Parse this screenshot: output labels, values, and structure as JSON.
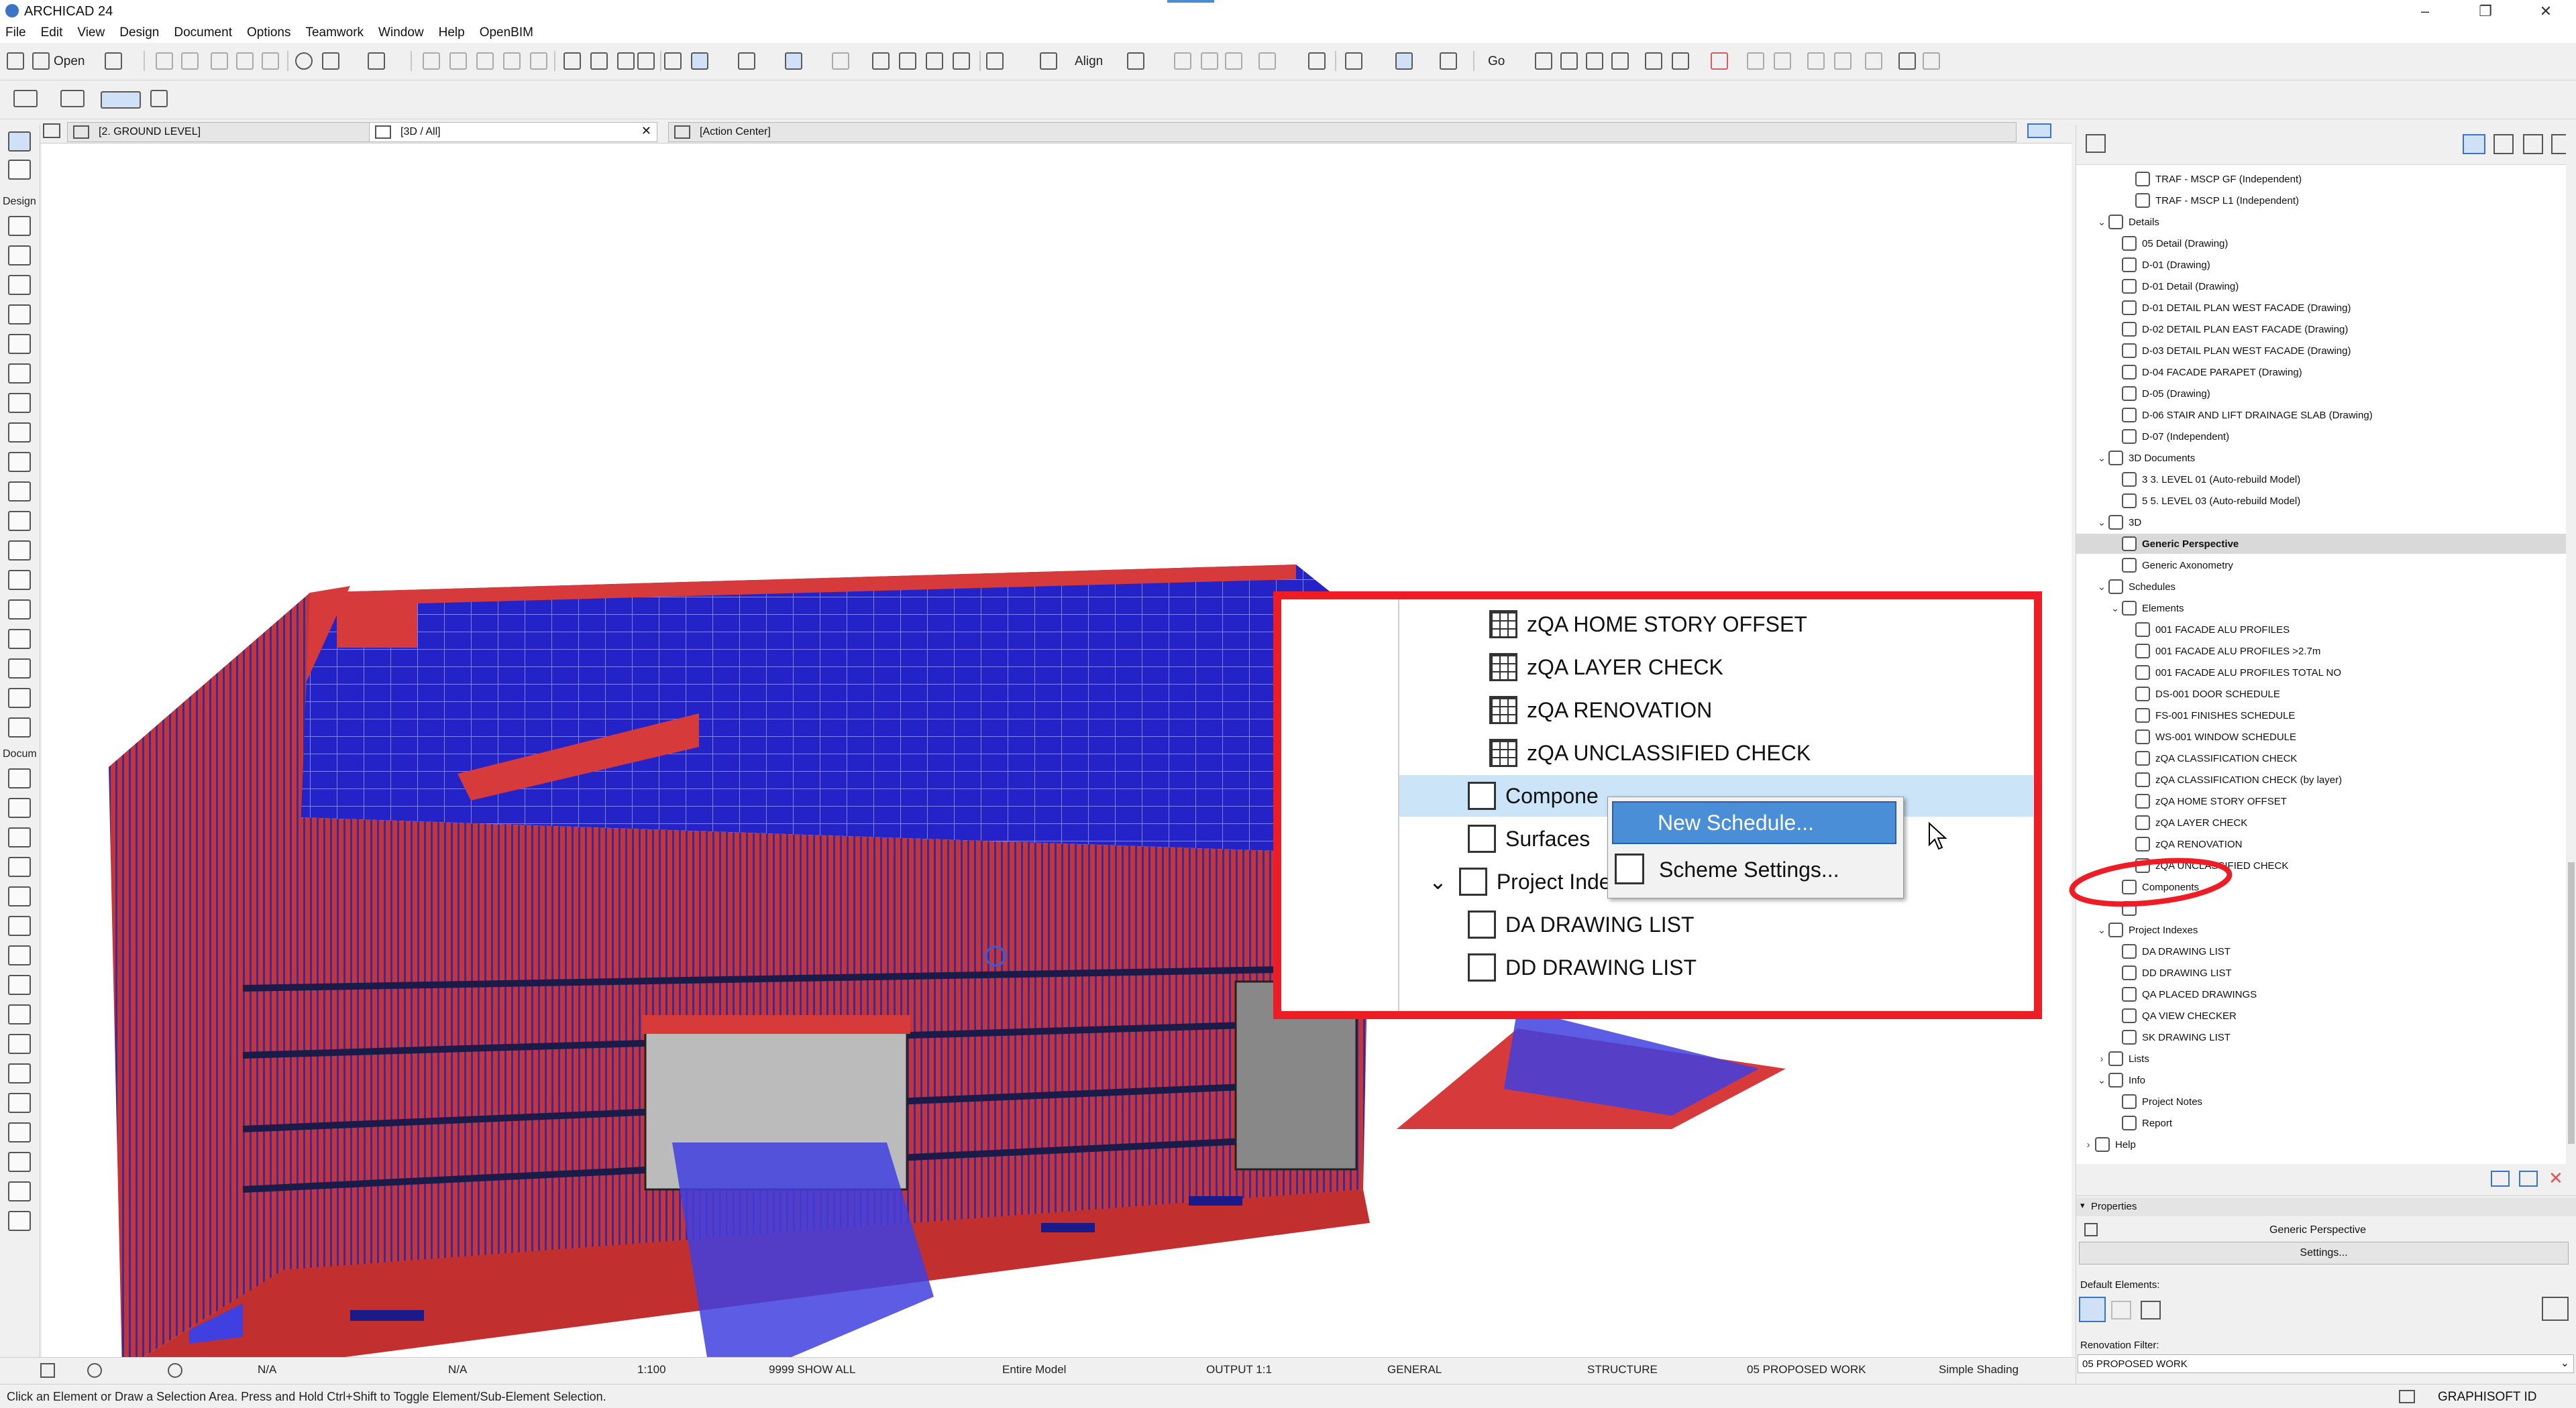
{
  "app": {
    "title": "ARCHICAD 24"
  },
  "menu": [
    "File",
    "Edit",
    "View",
    "Design",
    "Document",
    "Options",
    "Teamwork",
    "Window",
    "Help",
    "OpenBIM"
  ],
  "toolbar": {
    "open_label": "Open",
    "align_label": "Align",
    "go_label": "Go"
  },
  "left_toolbox": {
    "design_label": "Design",
    "document_label": "Docum"
  },
  "tabs": [
    {
      "label": "[2. GROUND LEVEL]"
    },
    {
      "label": "[3D / All]"
    },
    {
      "label": "[Action Center]"
    }
  ],
  "status": {
    "angle1": "N/A",
    "angle2": "N/A",
    "scale": "1:100",
    "layer_combo": "9999 SHOW ALL",
    "model": "Entire Model",
    "output": "OUTPUT 1:1",
    "general": "GENERAL",
    "structure": "STRUCTURE",
    "renovation": "05 PROPOSED WORK",
    "shading": "Simple Shading"
  },
  "hint": "Click an Element or Draw a Selection Area. Press and Hold Ctrl+Shift to Toggle Element/Sub-Element Selection.",
  "navigator": [
    {
      "label": "TRAF - MSCP GF (Independent)",
      "level": 3
    },
    {
      "label": "TRAF - MSCP L1 (Independent)",
      "level": 3
    },
    {
      "label": "Details",
      "level": 1,
      "expander": "⌄"
    },
    {
      "label": "05 Detail (Drawing)",
      "level": 2
    },
    {
      "label": "D-01 (Drawing)",
      "level": 2
    },
    {
      "label": "D-01 Detail (Drawing)",
      "level": 2
    },
    {
      "label": "D-01 DETAIL PLAN WEST FACADE (Drawing)",
      "level": 2
    },
    {
      "label": "D-02 DETAIL PLAN EAST FACADE (Drawing)",
      "level": 2
    },
    {
      "label": "D-03 DETAIL PLAN WEST FACADE (Drawing)",
      "level": 2
    },
    {
      "label": "D-04 FACADE PARAPET  (Drawing)",
      "level": 2
    },
    {
      "label": "D-05 (Drawing)",
      "level": 2
    },
    {
      "label": "D-06 STAIR AND LIFT DRAINAGE SLAB (Drawing)",
      "level": 2
    },
    {
      "label": "D-07 (Independent)",
      "level": 2
    },
    {
      "label": "3D Documents",
      "level": 1,
      "expander": "⌄"
    },
    {
      "label": "3 3. LEVEL 01 (Auto-rebuild Model)",
      "level": 2
    },
    {
      "label": "5 5. LEVEL 03 (Auto-rebuild Model)",
      "level": 2
    },
    {
      "label": "3D",
      "level": 1,
      "expander": "⌄"
    },
    {
      "label": "Generic Perspective",
      "level": 2,
      "selected": true
    },
    {
      "label": "Generic Axonometry",
      "level": 2
    },
    {
      "label": "Schedules",
      "level": 1,
      "expander": "⌄"
    },
    {
      "label": "Elements",
      "level": 2,
      "expander": "⌄"
    },
    {
      "label": "001 FACADE ALU PROFILES",
      "level": 3
    },
    {
      "label": "001 FACADE ALU PROFILES >2.7m",
      "level": 3
    },
    {
      "label": "001 FACADE ALU PROFILES TOTAL NO",
      "level": 3
    },
    {
      "label": "DS-001 DOOR SCHEDULE",
      "level": 3
    },
    {
      "label": "FS-001 FINISHES SCHEDULE",
      "level": 3
    },
    {
      "label": "WS-001 WINDOW SCHEDULE",
      "level": 3
    },
    {
      "label": "zQA CLASSIFICATION CHECK",
      "level": 3
    },
    {
      "label": "zQA CLASSIFICATION CHECK (by layer)",
      "level": 3
    },
    {
      "label": "zQA HOME STORY OFFSET",
      "level": 3
    },
    {
      "label": "zQA LAYER CHECK",
      "level": 3
    },
    {
      "label": "zQA RENOVATION",
      "level": 3
    },
    {
      "label": "zQA UNCLASSIFIED CHECK",
      "level": 3
    },
    {
      "label": "Components",
      "level": 2
    },
    {
      "label": "",
      "level": 2
    },
    {
      "label": "Project Indexes",
      "level": 1,
      "expander": "⌄"
    },
    {
      "label": "DA DRAWING LIST",
      "level": 2
    },
    {
      "label": "DD DRAWING LIST",
      "level": 2
    },
    {
      "label": "QA PLACED DRAWINGS",
      "level": 2
    },
    {
      "label": "QA VIEW CHECKER",
      "level": 2
    },
    {
      "label": "SK DRAWING LIST",
      "level": 2
    },
    {
      "label": "Lists",
      "level": 1,
      "expander": "›"
    },
    {
      "label": "Info",
      "level": 1,
      "expander": "⌄"
    },
    {
      "label": "Project Notes",
      "level": 2
    },
    {
      "label": "Report",
      "level": 2
    },
    {
      "label": "Help",
      "level": 0,
      "expander": "›"
    }
  ],
  "properties": {
    "header": "Properties",
    "view_name": "Generic Perspective",
    "settings_btn": "Settings...",
    "default_elements_label": "Default Elements:",
    "renovation_filter_label": "Renovation Filter:",
    "renovation_filter_value": "05 PROPOSED WORK",
    "brand": "GRAPHISOFT ID"
  },
  "zoom_callout": {
    "items": [
      {
        "label": "zQA HOME STORY OFFSET",
        "icon": "schedule-icon"
      },
      {
        "label": "zQA LAYER CHECK",
        "icon": "schedule-icon"
      },
      {
        "label": "zQA RENOVATION",
        "icon": "schedule-icon"
      },
      {
        "label": "zQA UNCLASSIFIED CHECK",
        "icon": "schedule-icon"
      },
      {
        "label": "Compone",
        "icon": "components-icon",
        "highlight": true
      },
      {
        "label": "Surfaces",
        "icon": "surfaces-icon"
      },
      {
        "label": "Project Index",
        "icon": "project-index-icon",
        "expander": "⌄"
      },
      {
        "label": "DA DRAWING LIST",
        "icon": "index-icon"
      },
      {
        "label": "DD DRAWING LIST",
        "icon": "index-icon"
      }
    ],
    "context_menu": [
      {
        "label": "New Schedule...",
        "highlight": true
      },
      {
        "label": "Scheme Settings..."
      }
    ]
  },
  "colors": {
    "accent_red": "#ee1c24",
    "model_red": "#d63a3a",
    "model_blue": "#2a2ad0",
    "selection_blue": "#4a8ed8"
  }
}
